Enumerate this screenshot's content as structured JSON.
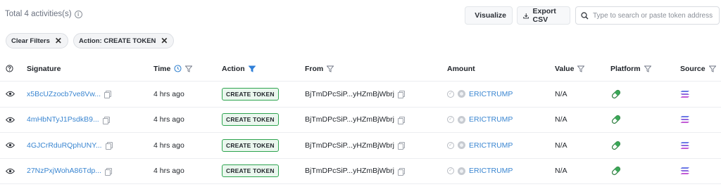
{
  "header": {
    "total_text": "Total 4 activities(s)",
    "visualize_label": "Visualize",
    "export_label": "Export CSV",
    "search_placeholder": "Type to search or paste token address"
  },
  "filters": {
    "clear_label": "Clear Filters",
    "action_chip_label": "Action: CREATE TOKEN"
  },
  "columns": {
    "signature": "Signature",
    "time": "Time",
    "action": "Action",
    "from": "From",
    "amount": "Amount",
    "value": "Value",
    "platform": "Platform",
    "source": "Source"
  },
  "rows": [
    {
      "signature": "x5BcUZzocb7ve8Vw...",
      "time": "4 hrs ago",
      "action": "CREATE TOKEN",
      "from": "BjTmDPcSiP...yHZmBjWbrj",
      "token": "ERICTRUMP",
      "value": "N/A"
    },
    {
      "signature": "4mHbNTyJ1PsdkB9...",
      "time": "4 hrs ago",
      "action": "CREATE TOKEN",
      "from": "BjTmDPcSiP...yHZmBjWbrj",
      "token": "ERICTRUMP",
      "value": "N/A"
    },
    {
      "signature": "4GJCrRduRQphUNY...",
      "time": "4 hrs ago",
      "action": "CREATE TOKEN",
      "from": "BjTmDPcSiP...yHZmBjWbrj",
      "token": "ERICTRUMP",
      "value": "N/A"
    },
    {
      "signature": "27NzPxjWohA86Tdp...",
      "time": "4 hrs ago",
      "action": "CREATE TOKEN",
      "from": "BjTmDPcSiP...yHZmBjWbrj",
      "token": "ERICTRUMP",
      "value": "N/A"
    }
  ],
  "icons": {
    "info": "info-circle-icon",
    "visualize": "chart-icon",
    "export": "download-icon",
    "search": "search-icon",
    "close": "close-icon",
    "help": "question-circle-icon",
    "clock": "clock-icon",
    "filter": "funnel-icon",
    "view": "eye-icon",
    "copy": "copy-icon",
    "platform": "pill-icon",
    "source": "solana-icon"
  },
  "colors": {
    "link": "#3a86d1",
    "badge_border": "#2ea44f",
    "badge_bg": "#eaf7ee",
    "active_filter": "#2f7fd8",
    "platform_green": "#3aa757"
  }
}
